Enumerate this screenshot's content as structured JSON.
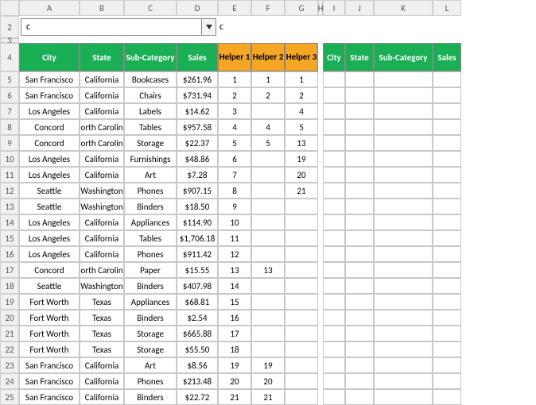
{
  "cols": [
    "A",
    "B",
    "C",
    "D",
    "E",
    "F",
    "G",
    "H",
    "I",
    "J",
    "K",
    "L"
  ],
  "dropdown": {
    "value": "c",
    "display": "c"
  },
  "headers_left": [
    "City",
    "State",
    "Sub-Category",
    "Sales"
  ],
  "headers_helper": [
    "Helper 1",
    "Helper 2",
    "Helper 3"
  ],
  "headers_right": [
    "City",
    "State",
    "Sub-Category",
    "Sales"
  ],
  "chart_data": {
    "type": "table",
    "columns": [
      "City",
      "State",
      "Sub-Category",
      "Sales",
      "Helper 1",
      "Helper 2",
      "Helper 3"
    ],
    "rows": [
      [
        "San Francisco",
        "California",
        "Bookcases",
        "$261.96",
        "1",
        "1",
        "1"
      ],
      [
        "San Francisco",
        "California",
        "Chairs",
        "$731.94",
        "2",
        "2",
        "2"
      ],
      [
        "Los Angeles",
        "California",
        "Labels",
        "$14.62",
        "3",
        "",
        "4"
      ],
      [
        "Concord",
        "orth Carolin",
        "Tables",
        "$957.58",
        "4",
        "4",
        "5"
      ],
      [
        "Concord",
        "orth Carolin",
        "Storage",
        "$22.37",
        "5",
        "5",
        "13"
      ],
      [
        "Los Angeles",
        "California",
        "Furnishings",
        "$48.86",
        "6",
        "",
        "19"
      ],
      [
        "Los Angeles",
        "California",
        "Art",
        "$7.28",
        "7",
        "",
        "20"
      ],
      [
        "Seattle",
        "Washington",
        "Phones",
        "$907.15",
        "8",
        "",
        "21"
      ],
      [
        "Seattle",
        "Washington",
        "Binders",
        "$18.50",
        "9",
        "",
        ""
      ],
      [
        "Los Angeles",
        "California",
        "Appliances",
        "$114.90",
        "10",
        "",
        ""
      ],
      [
        "Los Angeles",
        "California",
        "Tables",
        "$1,706.18",
        "11",
        "",
        ""
      ],
      [
        "Los Angeles",
        "California",
        "Phones",
        "$911.42",
        "12",
        "",
        ""
      ],
      [
        "Concord",
        "orth Carolin",
        "Paper",
        "$15.55",
        "13",
        "13",
        ""
      ],
      [
        "Seattle",
        "Washington",
        "Binders",
        "$407.98",
        "14",
        "",
        ""
      ],
      [
        "Fort Worth",
        "Texas",
        "Appliances",
        "$68.81",
        "15",
        "",
        ""
      ],
      [
        "Fort Worth",
        "Texas",
        "Binders",
        "$2.54",
        "16",
        "",
        ""
      ],
      [
        "Fort Worth",
        "Texas",
        "Storage",
        "$665.88",
        "17",
        "",
        ""
      ],
      [
        "Fort Worth",
        "Texas",
        "Storage",
        "$55.50",
        "18",
        "",
        ""
      ],
      [
        "San Francisco",
        "California",
        "Art",
        "$8.56",
        "19",
        "19",
        ""
      ],
      [
        "San Francisco",
        "California",
        "Phones",
        "$213.48",
        "20",
        "20",
        ""
      ],
      [
        "San Francisco",
        "California",
        "Binders",
        "$22.72",
        "21",
        "21",
        ""
      ]
    ]
  }
}
